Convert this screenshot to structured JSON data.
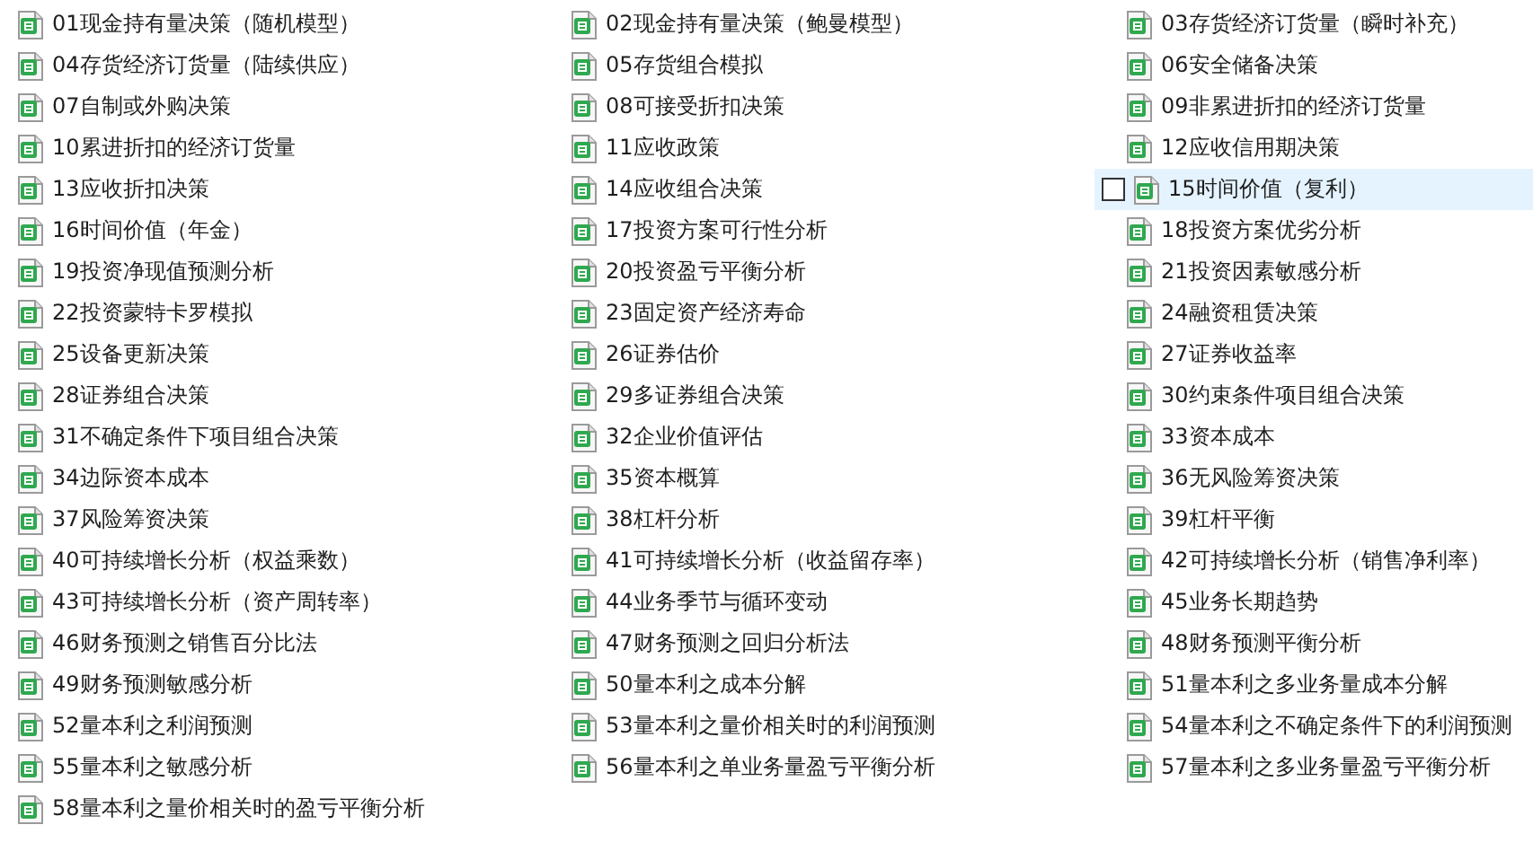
{
  "files": [
    {
      "name": "01现金持有量决策（随机模型）",
      "selected": false
    },
    {
      "name": "02现金持有量决策（鲍曼模型）",
      "selected": false
    },
    {
      "name": "03存货经济订货量（瞬时补充）",
      "selected": false
    },
    {
      "name": "04存货经济订货量（陆续供应）",
      "selected": false
    },
    {
      "name": "05存货组合模拟",
      "selected": false
    },
    {
      "name": "06安全储备决策",
      "selected": false
    },
    {
      "name": "07自制或外购决策",
      "selected": false
    },
    {
      "name": "08可接受折扣决策",
      "selected": false
    },
    {
      "name": "09非累进折扣的经济订货量",
      "selected": false
    },
    {
      "name": "10累进折扣的经济订货量",
      "selected": false
    },
    {
      "name": "11应收政策",
      "selected": false
    },
    {
      "name": "12应收信用期决策",
      "selected": false
    },
    {
      "name": "13应收折扣决策",
      "selected": false
    },
    {
      "name": "14应收组合决策",
      "selected": false
    },
    {
      "name": "15时间价值（复利）",
      "selected": true
    },
    {
      "name": "16时间价值（年金）",
      "selected": false
    },
    {
      "name": "17投资方案可行性分析",
      "selected": false
    },
    {
      "name": "18投资方案优劣分析",
      "selected": false
    },
    {
      "name": "19投资净现值预测分析",
      "selected": false
    },
    {
      "name": "20投资盈亏平衡分析",
      "selected": false
    },
    {
      "name": "21投资因素敏感分析",
      "selected": false
    },
    {
      "name": "22投资蒙特卡罗模拟",
      "selected": false
    },
    {
      "name": "23固定资产经济寿命",
      "selected": false
    },
    {
      "name": "24融资租赁决策",
      "selected": false
    },
    {
      "name": "25设备更新决策",
      "selected": false
    },
    {
      "name": "26证券估价",
      "selected": false
    },
    {
      "name": "27证券收益率",
      "selected": false
    },
    {
      "name": "28证券组合决策",
      "selected": false
    },
    {
      "name": "29多证券组合决策",
      "selected": false
    },
    {
      "name": "30约束条件项目组合决策",
      "selected": false
    },
    {
      "name": "31不确定条件下项目组合决策",
      "selected": false
    },
    {
      "name": "32企业价值评估",
      "selected": false
    },
    {
      "name": "33资本成本",
      "selected": false
    },
    {
      "name": "34边际资本成本",
      "selected": false
    },
    {
      "name": "35资本概算",
      "selected": false
    },
    {
      "name": "36无风险筹资决策",
      "selected": false
    },
    {
      "name": "37风险筹资决策",
      "selected": false
    },
    {
      "name": "38杠杆分析",
      "selected": false
    },
    {
      "name": "39杠杆平衡",
      "selected": false
    },
    {
      "name": "40可持续增长分析（权益乘数）",
      "selected": false
    },
    {
      "name": "41可持续增长分析（收益留存率）",
      "selected": false
    },
    {
      "name": "42可持续增长分析（销售净利率）",
      "selected": false
    },
    {
      "name": "43可持续增长分析（资产周转率）",
      "selected": false
    },
    {
      "name": "44业务季节与循环变动",
      "selected": false
    },
    {
      "name": "45业务长期趋势",
      "selected": false
    },
    {
      "name": "46财务预测之销售百分比法",
      "selected": false
    },
    {
      "name": "47财务预测之回归分析法",
      "selected": false
    },
    {
      "name": "48财务预测平衡分析",
      "selected": false
    },
    {
      "name": "49财务预测敏感分析",
      "selected": false
    },
    {
      "name": "50量本利之成本分解",
      "selected": false
    },
    {
      "name": "51量本利之多业务量成本分解",
      "selected": false
    },
    {
      "name": "52量本利之利润预测",
      "selected": false
    },
    {
      "name": "53量本利之量价相关时的利润预测",
      "selected": false
    },
    {
      "name": "54量本利之不确定条件下的利润预测",
      "selected": false
    },
    {
      "name": "55量本利之敏感分析",
      "selected": false
    },
    {
      "name": "56量本利之单业务量盈亏平衡分析",
      "selected": false
    },
    {
      "name": "57量本利之多业务量盈亏平衡分析",
      "selected": false
    },
    {
      "name": "58量本利之量价相关时的盈亏平衡分析",
      "selected": false
    }
  ]
}
